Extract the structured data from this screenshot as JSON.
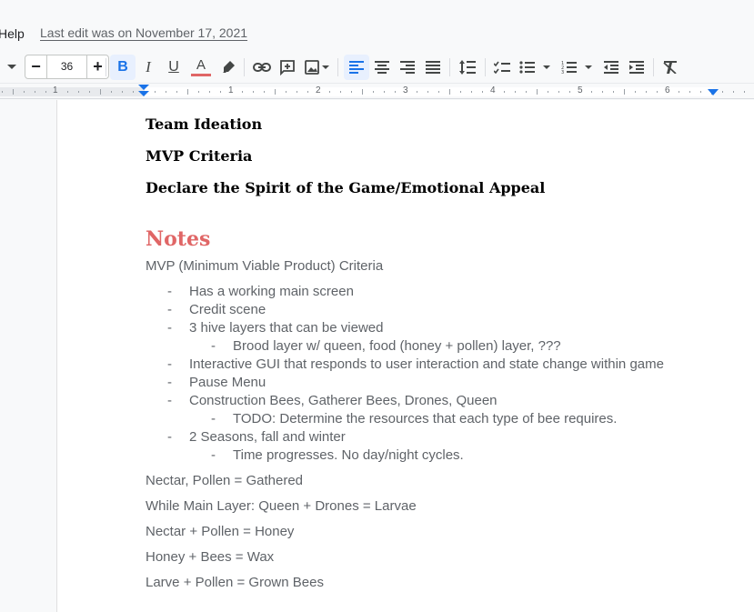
{
  "menubar": {
    "help_label": "Help",
    "last_edit": "Last edit was on November 17, 2021"
  },
  "toolbar": {
    "font_size": "36",
    "minus_label": "−",
    "plus_label": "+",
    "bold_label": "B",
    "italic_label": "I",
    "underline_label": "U",
    "text_color_label": "A",
    "text_color": "#e06666",
    "accent_color": "#1a73e8"
  },
  "ruler": {
    "numbers": [
      "1",
      "1",
      "2",
      "3",
      "4",
      "5",
      "6"
    ]
  },
  "document": {
    "headings": [
      "Team Ideation",
      "MVP Criteria",
      "Declare the Spirit of the Game/Emotional Appeal"
    ],
    "notes_title": "Notes",
    "notes_color": "#e06666",
    "mvp_intro": "MVP (Minimum Viable Product) Criteria",
    "bullet_dash": "-",
    "list": [
      {
        "level": 1,
        "text": "Has a working main screen"
      },
      {
        "level": 1,
        "text": "Credit scene"
      },
      {
        "level": 1,
        "text": "3 hive layers that can be viewed"
      },
      {
        "level": 2,
        "text": "Brood layer w/ queen, food (honey + pollen) layer, ???"
      },
      {
        "level": 1,
        "text": "Interactive GUI that responds to user interaction and state change within game"
      },
      {
        "level": 1,
        "text": "Pause Menu"
      },
      {
        "level": 1,
        "text": "Construction Bees, Gatherer Bees, Drones, Queen"
      },
      {
        "level": 2,
        "text": "TODO: Determine the resources that each type of bee requires."
      },
      {
        "level": 1,
        "text": "2 Seasons, fall and winter"
      },
      {
        "level": 2,
        "text": "Time progresses. No day/night cycles."
      }
    ],
    "paragraphs": [
      "Nectar, Pollen = Gathered",
      "While Main Layer: Queen + Drones = Larvae",
      "Nectar + Pollen = Honey",
      "Honey + Bees = Wax",
      "Larve + Pollen = Grown Bees"
    ]
  }
}
